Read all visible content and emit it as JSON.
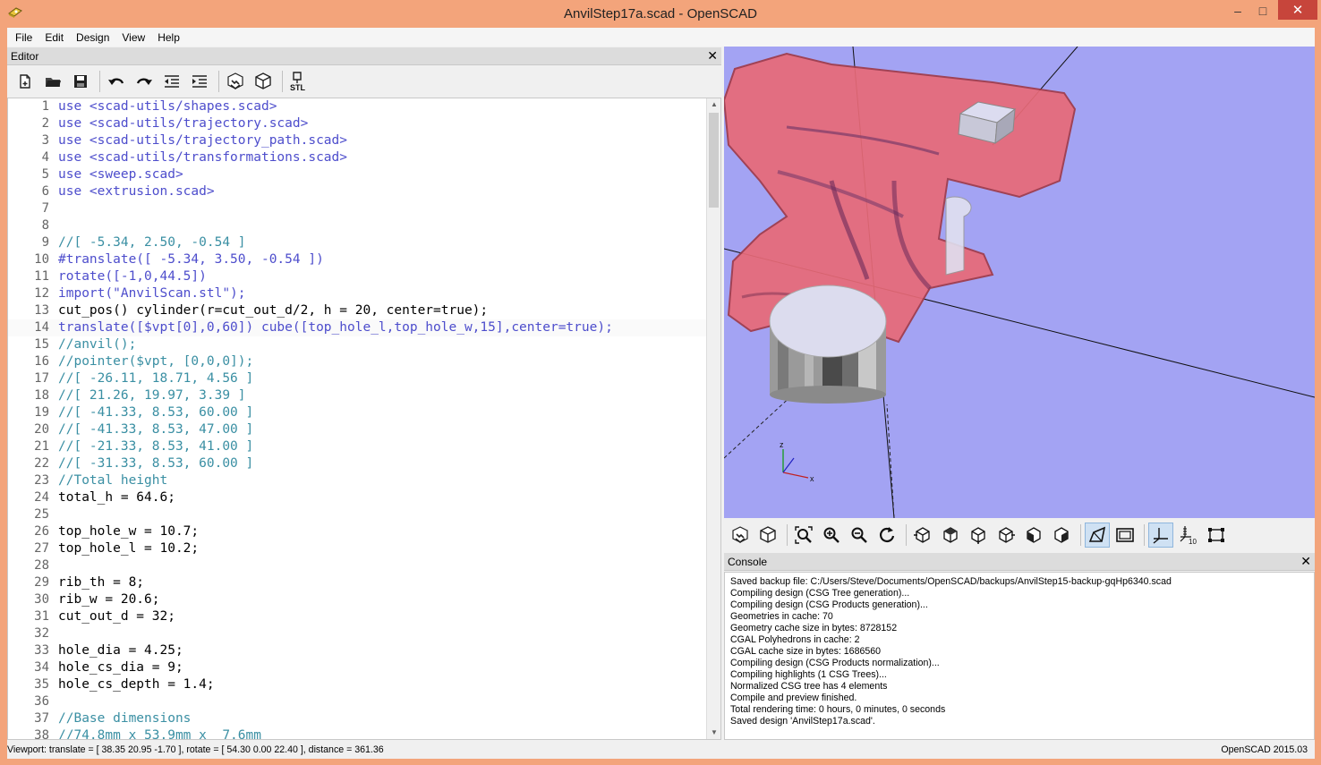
{
  "window": {
    "title": "AnvilStep17a.scad - OpenSCAD",
    "minimize_label": "–",
    "maximize_label": "□",
    "close_label": "✕"
  },
  "menu": [
    "File",
    "Edit",
    "Design",
    "View",
    "Help"
  ],
  "editor": {
    "title": "Editor",
    "close_label": "✕",
    "toolbar": [
      {
        "name": "new-file-icon"
      },
      {
        "name": "open-file-icon"
      },
      {
        "name": "save-icon"
      },
      {
        "name": "undo-icon"
      },
      {
        "name": "redo-icon"
      },
      {
        "name": "unindent-icon"
      },
      {
        "name": "indent-icon"
      },
      {
        "name": "preview-icon"
      },
      {
        "name": "render-icon"
      },
      {
        "name": "export-stl-icon",
        "label": "STL"
      }
    ],
    "lines": [
      {
        "n": "1",
        "t": "use <scad-utils/shapes.scad>"
      },
      {
        "n": "2",
        "t": "use <scad-utils/trajectory.scad>"
      },
      {
        "n": "3",
        "t": "use <scad-utils/trajectory_path.scad>"
      },
      {
        "n": "4",
        "t": "use <scad-utils/transformations.scad>"
      },
      {
        "n": "5",
        "t": "use <sweep.scad>"
      },
      {
        "n": "6",
        "t": "use <extrusion.scad>"
      },
      {
        "n": "7",
        "t": ""
      },
      {
        "n": "8",
        "t": ""
      },
      {
        "n": "9",
        "t": "//[ -5.34, 2.50, -0.54 ]"
      },
      {
        "n": "10",
        "t": "#translate([ -5.34, 3.50, -0.54 ])"
      },
      {
        "n": "11",
        "t": "rotate([-1,0,44.5])"
      },
      {
        "n": "12",
        "t": "import(\"AnvilScan.stl\");"
      },
      {
        "n": "13",
        "t": "cut_pos() cylinder(r=cut_out_d/2, h = 20, center=true);"
      },
      {
        "n": "14",
        "t": "translate([$vpt[0],0,60]) cube([top_hole_l,top_hole_w,15],center=true);"
      },
      {
        "n": "15",
        "t": "//anvil();"
      },
      {
        "n": "16",
        "t": "//pointer($vpt, [0,0,0]);"
      },
      {
        "n": "17",
        "t": "//[ -26.11, 18.71, 4.56 ]"
      },
      {
        "n": "18",
        "t": "//[ 21.26, 19.97, 3.39 ]"
      },
      {
        "n": "19",
        "t": "//[ -41.33, 8.53, 60.00 ]"
      },
      {
        "n": "20",
        "t": "//[ -41.33, 8.53, 47.00 ]"
      },
      {
        "n": "21",
        "t": "//[ -21.33, 8.53, 41.00 ]"
      },
      {
        "n": "22",
        "t": "//[ -31.33, 8.53, 60.00 ]"
      },
      {
        "n": "23",
        "t": "//Total height"
      },
      {
        "n": "24",
        "t": "total_h = 64.6;"
      },
      {
        "n": "25",
        "t": ""
      },
      {
        "n": "26",
        "t": "top_hole_w = 10.7;"
      },
      {
        "n": "27",
        "t": "top_hole_l = 10.2;"
      },
      {
        "n": "28",
        "t": ""
      },
      {
        "n": "29",
        "t": "rib_th = 8;"
      },
      {
        "n": "30",
        "t": "rib_w = 20.6;"
      },
      {
        "n": "31",
        "t": "cut_out_d = 32;"
      },
      {
        "n": "32",
        "t": ""
      },
      {
        "n": "33",
        "t": "hole_dia = 4.25;"
      },
      {
        "n": "34",
        "t": "hole_cs_dia = 9;"
      },
      {
        "n": "35",
        "t": "hole_cs_depth = 1.4;"
      },
      {
        "n": "36",
        "t": ""
      },
      {
        "n": "37",
        "t": "//Base dimensions"
      },
      {
        "n": "38",
        "t": "//74.8mm x 53.9mm x  7.6mm"
      }
    ]
  },
  "viewport": {
    "background": "#a3a3f3",
    "axis_labels": {
      "x": "x",
      "y": "y",
      "z": "z"
    },
    "toolbar": [
      {
        "name": "preview-icon"
      },
      {
        "name": "render-icon"
      },
      {
        "name": "view-all-icon"
      },
      {
        "name": "zoom-in-icon"
      },
      {
        "name": "zoom-out-icon"
      },
      {
        "name": "reset-view-icon"
      },
      {
        "name": "view-right-icon"
      },
      {
        "name": "view-top-icon"
      },
      {
        "name": "view-bottom-icon"
      },
      {
        "name": "view-left-icon"
      },
      {
        "name": "view-front-icon"
      },
      {
        "name": "view-back-icon"
      },
      {
        "name": "perspective-icon",
        "active": true
      },
      {
        "name": "orthogonal-icon"
      },
      {
        "name": "show-axes-icon",
        "active": true
      },
      {
        "name": "show-scale-icon",
        "label": "10"
      },
      {
        "name": "show-edges-icon"
      }
    ]
  },
  "console": {
    "title": "Console",
    "close_label": "✕",
    "lines": [
      "Saved backup file: C:/Users/Steve/Documents/OpenSCAD/backups/AnvilStep15-backup-gqHp6340.scad",
      "Compiling design (CSG Tree generation)...",
      "Compiling design (CSG Products generation)...",
      "Geometries in cache: 70",
      "Geometry cache size in bytes: 8728152",
      "CGAL Polyhedrons in cache: 2",
      "CGAL cache size in bytes: 1686560",
      "Compiling design (CSG Products normalization)...",
      "Compiling highlights (1 CSG Trees)...",
      "Normalized CSG tree has 4 elements",
      "Compile and preview finished.",
      "Total rendering time: 0 hours, 0 minutes, 0 seconds",
      "Saved design 'AnvilStep17a.scad'."
    ]
  },
  "status": {
    "viewport": "Viewport: translate = [ 38.35 20.95 -1.70 ], rotate = [ 54.30 0.00 22.40 ], distance = 361.36",
    "version": "OpenSCAD 2015.03"
  }
}
